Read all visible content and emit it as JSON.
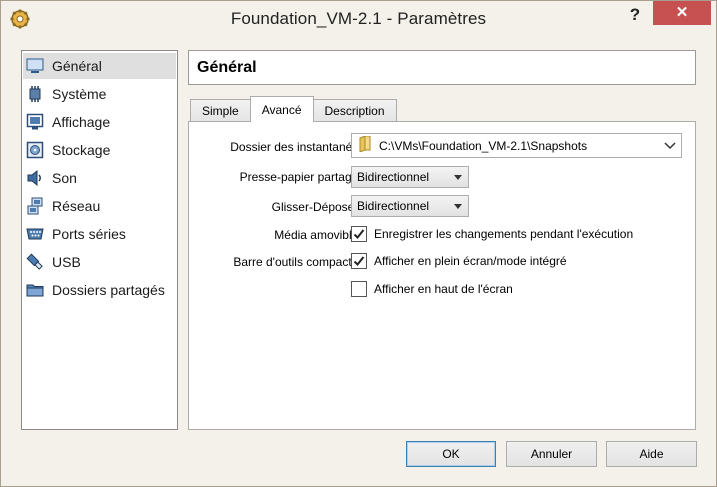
{
  "window": {
    "title": "Foundation_VM-2.1 - Paramètres",
    "help_label": "?",
    "close_label": "✕"
  },
  "sidebar": {
    "items": [
      {
        "label": "Général",
        "icon": "general-icon",
        "selected": true
      },
      {
        "label": "Système",
        "icon": "system-icon"
      },
      {
        "label": "Affichage",
        "icon": "display-icon"
      },
      {
        "label": "Stockage",
        "icon": "storage-icon"
      },
      {
        "label": "Son",
        "icon": "sound-icon"
      },
      {
        "label": "Réseau",
        "icon": "network-icon"
      },
      {
        "label": "Ports séries",
        "icon": "serial-ports-icon"
      },
      {
        "label": "USB",
        "icon": "usb-icon"
      },
      {
        "label": "Dossiers partagés",
        "icon": "shared-folders-icon"
      }
    ]
  },
  "section": {
    "title": "Général"
  },
  "tabs": [
    {
      "label": "Simple",
      "active": false
    },
    {
      "label": "Avancé",
      "active": true
    },
    {
      "label": "Description",
      "active": false
    }
  ],
  "form": {
    "snapshot_folder_label": "Dossier des instantanés :",
    "snapshot_folder_value": "C:\\VMs\\Foundation_VM-2.1\\Snapshots",
    "clipboard_label": "Presse-papier partagé :",
    "clipboard_value": "Bidirectionnel",
    "dragdrop_label": "Glisser-Déposer :",
    "dragdrop_value": "Bidirectionnel",
    "removable_media_label": "Média amovible :",
    "removable_media_checkbox": "Enregistrer les changements pendant l'exécution",
    "removable_media_checked": true,
    "minitoolbar_label": "Barre d'outils compacte :",
    "minitoolbar_fullscreen": "Afficher en plein écran/mode intégré",
    "minitoolbar_fullscreen_checked": true,
    "minitoolbar_top": "Afficher en haut de l'écran",
    "minitoolbar_top_checked": false
  },
  "buttons": {
    "ok": "OK",
    "cancel": "Annuler",
    "help": "Aide"
  }
}
